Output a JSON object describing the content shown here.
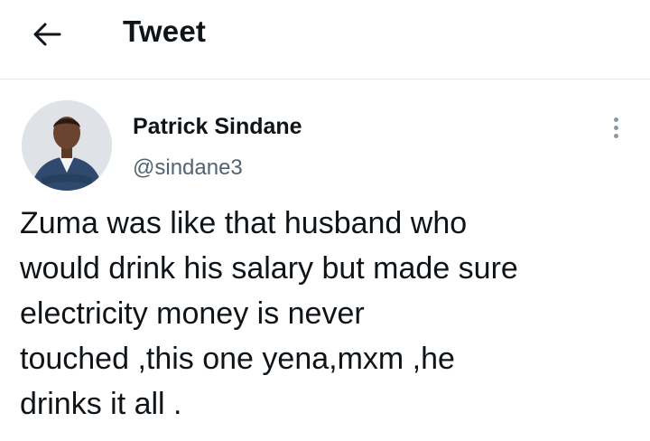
{
  "header": {
    "back_icon": "arrow-left-icon",
    "title": "Tweet"
  },
  "tweet": {
    "author": {
      "display_name": "Patrick Sindane",
      "handle": "@sindane3",
      "avatar": "avatar-photo"
    },
    "more_icon": "more-vertical-icon",
    "text_lines": [
      "Zuma was like that husband who",
      "would drink his salary but made sure",
      "electricity money is never",
      "touched ,this one yena,mxm ,he",
      "drinks it all ."
    ]
  },
  "colors": {
    "text_primary": "#0f1419",
    "text_secondary": "#536471",
    "divider": "#e4e6e8"
  }
}
